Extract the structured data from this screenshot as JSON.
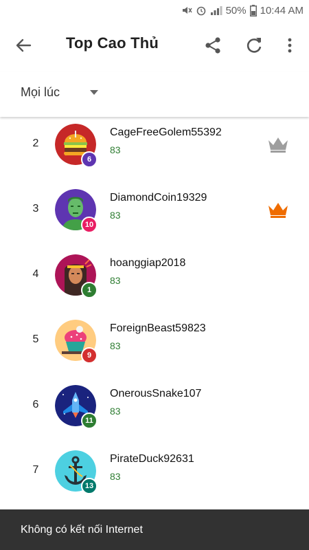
{
  "status_bar": {
    "battery": "50%",
    "time": "10:44 AM"
  },
  "toolbar": {
    "title": "Top Cao Thủ"
  },
  "filter": {
    "selected": "Mọi lúc"
  },
  "leaders": [
    {
      "rank": "2",
      "name": "CageFreeGolem55392",
      "score": "83",
      "level": "6",
      "badge_color": "#5e35b1",
      "avatar": "burger-avatar-icon",
      "crown": "silver"
    },
    {
      "rank": "3",
      "name": "DiamondCoin19329",
      "score": "83",
      "level": "10",
      "badge_color": "#e91e63",
      "avatar": "green-man-avatar-icon",
      "crown": "orange"
    },
    {
      "rank": "4",
      "name": "hoanggiap2018",
      "score": "83",
      "level": "1",
      "badge_color": "#2e7d32",
      "avatar": "native-avatar-icon"
    },
    {
      "rank": "5",
      "name": "ForeignBeast59823",
      "score": "83",
      "level": "9",
      "badge_color": "#d32f2f",
      "avatar": "cupcake-avatar-icon"
    },
    {
      "rank": "6",
      "name": "OnerousSnake107",
      "score": "83",
      "level": "11",
      "badge_color": "#2e7d32",
      "avatar": "spaceship-avatar-icon"
    },
    {
      "rank": "7",
      "name": "PirateDuck92631",
      "score": "83",
      "level": "13",
      "badge_color": "#00796b",
      "avatar": "anchor-avatar-icon"
    }
  ],
  "snackbar": {
    "message": "Không có kết nối Internet"
  },
  "colors": {
    "score_green": "#2e7d32",
    "crown_silver": "#9e9e9e",
    "crown_orange": "#ef6c00",
    "snackbar_bg": "#323232"
  }
}
